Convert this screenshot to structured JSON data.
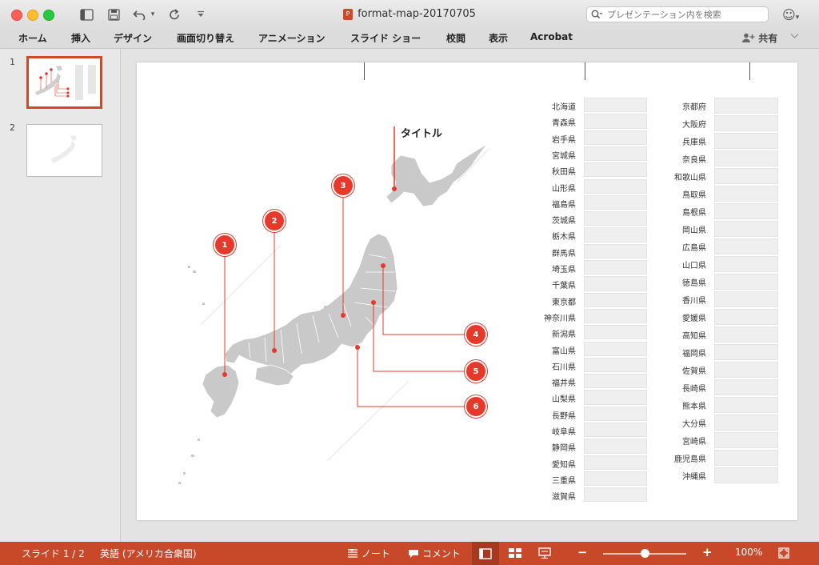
{
  "window": {
    "title": "format-map-20170705",
    "search_placeholder": "プレゼンテーション内を検索"
  },
  "ribbon": {
    "tabs": [
      "ホーム",
      "挿入",
      "デザイン",
      "画面切り替え",
      "アニメーション",
      "スライド ショー",
      "校閲",
      "表示",
      "Acrobat"
    ],
    "share_label": "共有"
  },
  "thumbnails": {
    "numbers": [
      "1",
      "2"
    ],
    "selected": 1
  },
  "slide": {
    "title": "タイトル",
    "markers": [
      "1",
      "2",
      "3",
      "4",
      "5",
      "6"
    ],
    "prefectures_left": [
      "北海道",
      "青森県",
      "岩手県",
      "宮城県",
      "秋田県",
      "山形県",
      "福島県",
      "茨城県",
      "栃木県",
      "群馬県",
      "埼玉県",
      "千葉県",
      "東京都",
      "神奈川県",
      "新潟県",
      "富山県",
      "石川県",
      "福井県",
      "山梨県",
      "長野県",
      "岐阜県",
      "静岡県",
      "愛知県",
      "三重県",
      "滋賀県"
    ],
    "prefectures_right": [
      "京都府",
      "大阪府",
      "兵庫県",
      "奈良県",
      "和歌山県",
      "鳥取県",
      "島根県",
      "岡山県",
      "広島県",
      "山口県",
      "徳島県",
      "香川県",
      "愛媛県",
      "高知県",
      "福岡県",
      "佐賀県",
      "長崎県",
      "熊本県",
      "大分県",
      "宮崎県",
      "鹿児島県",
      "沖縄県"
    ],
    "accent_color": "#e8382c",
    "map_color": "#c9c9c9"
  },
  "statusbar": {
    "slide_indicator": "スライド 1 / 2",
    "language": "英語 (アメリカ合衆国)",
    "notes_label": "ノート",
    "comments_label": "コメント",
    "zoom_minus": "−",
    "zoom_plus": "+",
    "zoom_level": "100%",
    "zoom_fraction": 0.5
  }
}
